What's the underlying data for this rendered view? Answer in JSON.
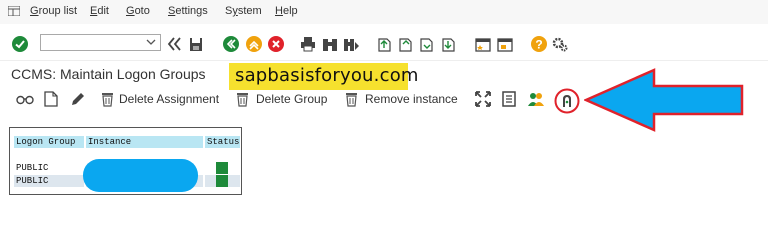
{
  "menubar": {
    "items": [
      {
        "label": "Group list",
        "hotkey": "G"
      },
      {
        "label": "Edit",
        "hotkey": "E"
      },
      {
        "label": "Goto",
        "hotkey": "G"
      },
      {
        "label": "Settings",
        "hotkey": "S"
      },
      {
        "label": "System",
        "hotkey": "y"
      },
      {
        "label": "Help",
        "hotkey": "H"
      }
    ]
  },
  "command_field": {
    "value": ""
  },
  "window": {
    "title": "CCMS: Maintain Logon Groups"
  },
  "watermark": {
    "text": "sapbasisforyou.com"
  },
  "toolbar": {
    "delete_assignment": "Delete Assignment",
    "delete_group": "Delete Group",
    "remove_instance": "Remove instance"
  },
  "table": {
    "headers": [
      "Logon Group",
      "Instance",
      "Status"
    ],
    "rows": [
      {
        "group": "PUBLIC",
        "instance": "",
        "status": "green"
      },
      {
        "group": "PUBLIC",
        "instance": "",
        "status": "green"
      }
    ]
  },
  "colors": {
    "accent_blue": "#0aa7f0",
    "highlight_red": "#e0222b",
    "watermark_yellow": "#f6e12e",
    "status_green": "#1e8a3a",
    "header_bg": "#b9e6f3"
  }
}
